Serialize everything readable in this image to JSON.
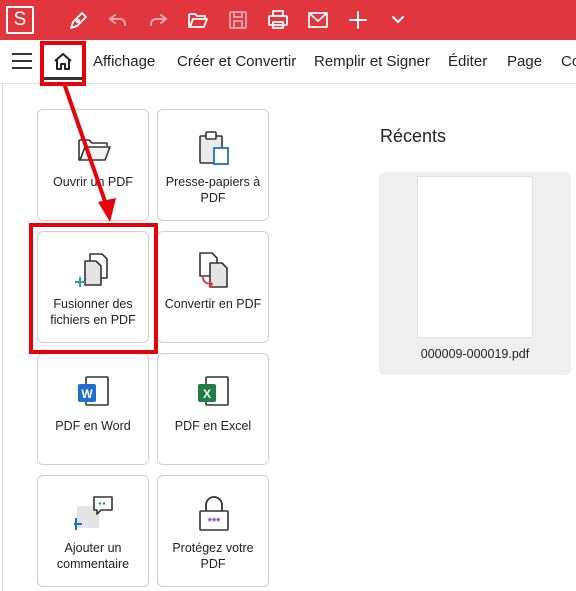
{
  "app": {
    "logo_letter": "S",
    "accent_color": "#e2363f",
    "annotation_color": "#e8000b"
  },
  "toolbar": {
    "icons": [
      "pen-icon",
      "undo-icon",
      "redo-icon",
      "open-folder-icon",
      "save-icon",
      "print-icon",
      "mail-icon",
      "plus-icon",
      "chevron-down-icon"
    ]
  },
  "menu": {
    "items": [
      "Affichage",
      "Créer et Convertir",
      "Remplir et Signer",
      "Éditer",
      "Page",
      "Co"
    ]
  },
  "tiles": [
    {
      "label": "Ouvrir un PDF",
      "icon": "open-folder-icon"
    },
    {
      "label": "Presse-papiers à PDF",
      "icon": "clipboard-icon"
    },
    {
      "label": "Fusionner des fichiers en PDF",
      "icon": "merge-files-icon"
    },
    {
      "label": "Convertir en PDF",
      "icon": "convert-icon"
    },
    {
      "label": "PDF en Word",
      "icon": "word-icon"
    },
    {
      "label": "PDF en Excel",
      "icon": "excel-icon"
    },
    {
      "label": "Ajouter un commentaire",
      "icon": "comment-icon"
    },
    {
      "label": "Protégez votre PDF",
      "icon": "lock-icon"
    }
  ],
  "recents": {
    "title": "Récents",
    "files": [
      {
        "name": "000009-000019.pdf"
      }
    ]
  }
}
